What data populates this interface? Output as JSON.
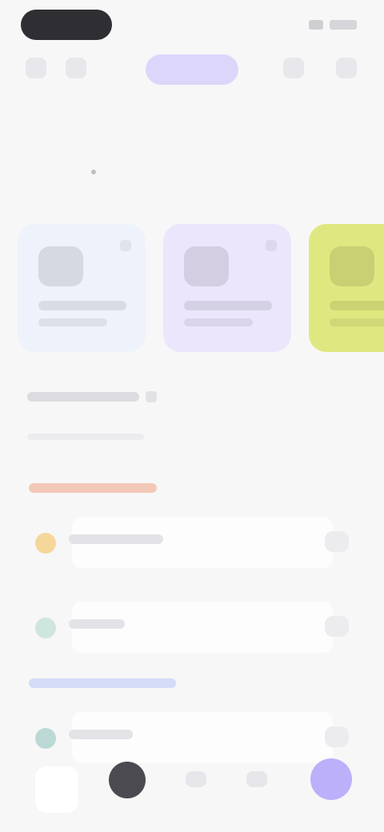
{
  "status_bar": {},
  "header": {},
  "title_row": {},
  "date_strip": {
    "days": [
      {
        "label": "",
        "active": false
      },
      {
        "label": "",
        "active": true
      },
      {
        "label": "",
        "active": false
      },
      {
        "label": "",
        "active": false
      },
      {
        "label": "",
        "active": false
      },
      {
        "label": "",
        "active": false
      },
      {
        "label": "",
        "active": false
      }
    ]
  },
  "cards": [
    {
      "bg": "#eef2fb"
    },
    {
      "bg": "#ebe6fc"
    },
    {
      "bg": "#dfe880"
    }
  ],
  "colors": {
    "accent": "#bdb0fa",
    "accent_pill": "#ddd6fb",
    "tag_orange": "#f4c8b8",
    "tag_blue": "#d3dbf6",
    "status_dark": "#2f2f33"
  },
  "list_items": [
    {
      "lead_color": "#f6d79a"
    },
    {
      "lead_color": "#cfe6dd"
    },
    {
      "lead_color": "#bcd9d6"
    }
  ]
}
